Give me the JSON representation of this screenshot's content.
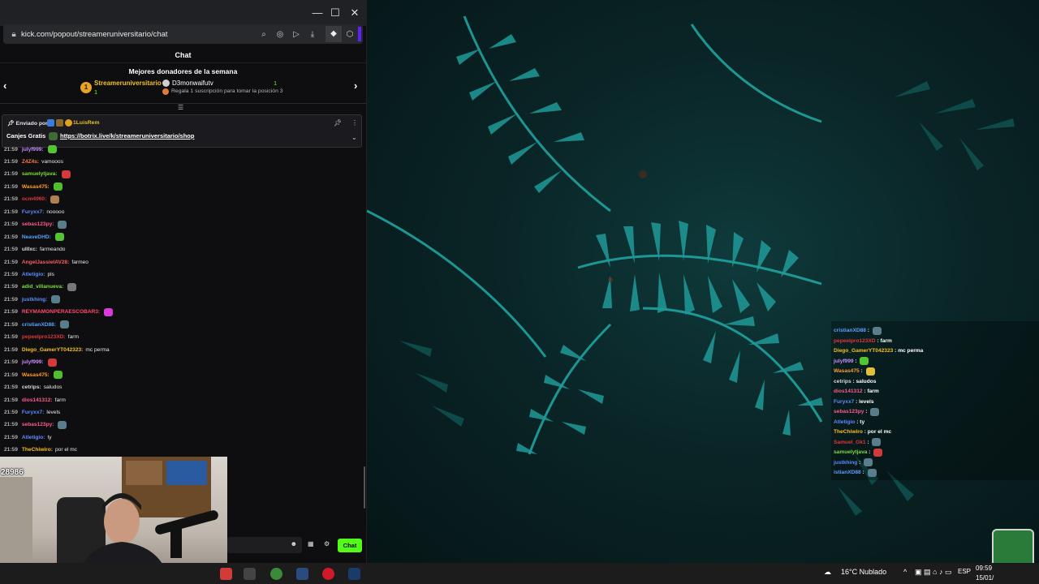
{
  "browser": {
    "url": "kick.com/popout/streameruniversitario/chat",
    "window_controls": [
      "—",
      "☐",
      "✕"
    ]
  },
  "chat": {
    "header": "Chat",
    "donors": {
      "title": "Mejores donadores de la semana",
      "first": {
        "rank": "1",
        "name": "Streameruniversitario",
        "count": "1"
      },
      "second": {
        "name": "D3monwaifutv",
        "count": "1"
      },
      "hint": "Regala 1 suscripción para tomar la posición 3"
    },
    "pinned": {
      "sent_by": "Enviado por",
      "user": "1LuisRem",
      "label": "Canjes Gratis",
      "link": "https://botrix.live/k/streameruniversitario/shop"
    },
    "messages": [
      {
        "time": "21:59",
        "user": "julyf999:",
        "color": "#c58cff",
        "text": "",
        "emote": "#53c433"
      },
      {
        "time": "21:59",
        "user": "Z4Z4s:",
        "color": "#ff7a3d",
        "text": "vamooos",
        "emote": ""
      },
      {
        "time": "21:59",
        "user": "samuelytjava:",
        "color": "#7ddc3a",
        "text": "",
        "emote": "#d33b3b"
      },
      {
        "time": "21:59",
        "user": "Wasas475:",
        "color": "#ff9b2f",
        "text": "",
        "emote": "#4fbf2c"
      },
      {
        "time": "21:59",
        "user": "ocm4960:",
        "color": "#e0353b",
        "text": "",
        "emote": "#b08050"
      },
      {
        "time": "21:59",
        "user": "Furyxx7:",
        "color": "#5b8cff",
        "text": "nooooo",
        "emote": ""
      },
      {
        "time": "21:59",
        "user": "sebas123py:",
        "color": "#ff5b8c",
        "text": "",
        "emote": "#5a7d8c"
      },
      {
        "time": "21:59",
        "user": "NeaveDHD:",
        "color": "#5aa0ff",
        "text": "",
        "emote": "#53c433"
      },
      {
        "time": "21:59",
        "user": "ulllxc:",
        "color": "#d9d9d9",
        "text": "farmeando",
        "emote": ""
      },
      {
        "time": "21:59",
        "user": "AngelJassielAV28:",
        "color": "#ff5b5b",
        "text": "farmeo",
        "emote": ""
      },
      {
        "time": "21:59",
        "user": "Atletigio:",
        "color": "#5b8cff",
        "text": "pls",
        "emote": ""
      },
      {
        "time": "21:59",
        "user": "adid_villanueva:",
        "color": "#7ddc3a",
        "text": "",
        "emote": "#777777"
      },
      {
        "time": "21:59",
        "user": "justkhing:",
        "color": "#5b8cff",
        "text": "",
        "emote": "#5a7d8c"
      },
      {
        "time": "21:59",
        "user": "REYMAMONPERAESCOBAR3:",
        "color": "#ff4b6e",
        "text": "",
        "emote": "#d93bd9"
      },
      {
        "time": "21:59",
        "user": "cristianXD88:",
        "color": "#5aa0ff",
        "text": "",
        "emote": "#5a7d8c"
      },
      {
        "time": "21:59",
        "user": "pepeelpro123XD:",
        "color": "#e0353b",
        "text": "farm",
        "emote": ""
      },
      {
        "time": "21:59",
        "user": "Diego_GamerYT042323:",
        "color": "#f2c024",
        "text": "mc perma",
        "emote": ""
      },
      {
        "time": "21:59",
        "user": "julyf999:",
        "color": "#c58cff",
        "text": "",
        "emote": "#d33b3b"
      },
      {
        "time": "21:59",
        "user": "Wasas475:",
        "color": "#ff9b2f",
        "text": "",
        "emote": "#4fbf2c"
      },
      {
        "time": "21:59",
        "user": "cetrips:",
        "color": "#d9d9d9",
        "text": "saludos",
        "emote": ""
      },
      {
        "time": "21:59",
        "user": "dios141312:",
        "color": "#ff5b8c",
        "text": "farm",
        "emote": ""
      },
      {
        "time": "21:59",
        "user": "Furyxx7:",
        "color": "#5b8cff",
        "text": "levels",
        "emote": ""
      },
      {
        "time": "21:59",
        "user": "sebas123py:",
        "color": "#ff5b8c",
        "text": "",
        "emote": "#5a7d8c"
      },
      {
        "time": "21:59",
        "user": "Atletigio:",
        "color": "#5b8cff",
        "text": "ty",
        "emote": ""
      },
      {
        "time": "21:59",
        "user": "TheChiwiro:",
        "color": "#f2c024",
        "text": "por el mc",
        "emote": ""
      }
    ],
    "send_button": "Chat"
  },
  "webcam": {
    "counter": "28986"
  },
  "overlay_chat": [
    {
      "user": "cristianXD88",
      "color": "#5aa0ff",
      "text": "",
      "emote": "#5a7d8c"
    },
    {
      "user": "pepeelpro123XD",
      "color": "#e0353b",
      "text": "farm",
      "emote": ""
    },
    {
      "user": "Diego_GamerYT042323",
      "color": "#f2c024",
      "text": "mc perma",
      "emote": ""
    },
    {
      "user": "julyf999",
      "color": "#c58cff",
      "text": "",
      "emote": "#53c433"
    },
    {
      "user": "Wasas475",
      "color": "#ff9b2f",
      "text": "",
      "emote": "#e0c03b"
    },
    {
      "user": "cetrips",
      "color": "#d9d9d9",
      "text": "saludos",
      "emote": ""
    },
    {
      "user": "dios141312",
      "color": "#ff5b8c",
      "text": "farm",
      "emote": ""
    },
    {
      "user": "Furyxx7",
      "color": "#5b8cff",
      "text": "levels",
      "emote": ""
    },
    {
      "user": "sebas123py",
      "color": "#ff5b8c",
      "text": "",
      "emote": "#5a7d8c"
    },
    {
      "user": "Atletigio",
      "color": "#5b8cff",
      "text": "ty",
      "emote": ""
    },
    {
      "user": "TheChiwiro",
      "color": "#f2c024",
      "text": "por el mc",
      "emote": ""
    },
    {
      "user": "Samuel_Gk1",
      "color": "#e0353b",
      "text": "",
      "emote": "#5a7d8c"
    },
    {
      "user": "samuelytjava",
      "color": "#7ddc3a",
      "text": "",
      "emote": "#d33b3b"
    },
    {
      "user": "justkhing",
      "color": "#5b8cff",
      "text": "",
      "emote": "#5a7d8c"
    },
    {
      "user": "istianXD88",
      "color": "#5aa0ff",
      "text": "",
      "emote": "#5a7d8c"
    }
  ],
  "taskbar": {
    "weather": "16°C  Nublado",
    "lang": "ESP",
    "time": "09:59",
    "date": "15/01/"
  }
}
